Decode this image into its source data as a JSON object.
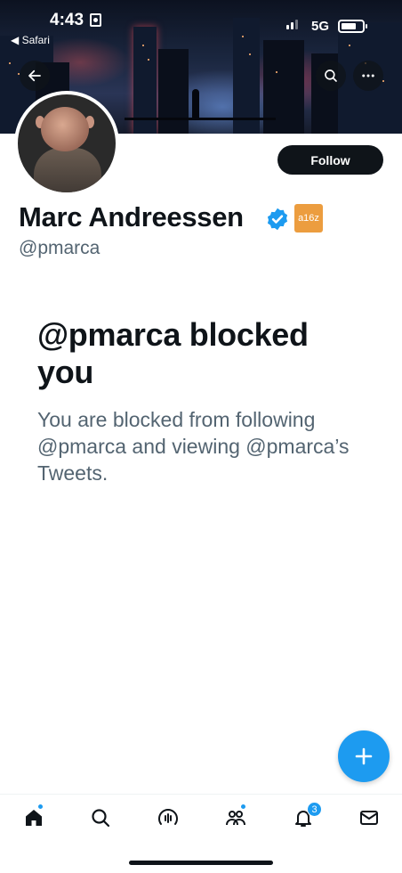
{
  "status_bar": {
    "time": "4:43",
    "back_app": "◀ Safari",
    "network": "5G"
  },
  "header": {
    "back_icon": "arrow-left-icon",
    "search_icon": "search-icon",
    "more_icon": "more-horizontal-icon"
  },
  "profile": {
    "display_name": "Marc Andreessen",
    "handle": "@pmarca",
    "affiliate_badge": "a16z",
    "follow_label": "Follow",
    "verified_color": "#1d9bf0",
    "affiliate_color": "#ec9d3f"
  },
  "blocked": {
    "title": "@pmarca blocked you",
    "description": "You are blocked from following @pmarca and viewing @pmarca’s Tweets."
  },
  "tab_bar": {
    "items": [
      {
        "name": "home",
        "icon": "home-icon",
        "has_dot": true
      },
      {
        "name": "search",
        "icon": "search-icon",
        "has_dot": false
      },
      {
        "name": "spaces",
        "icon": "spaces-icon",
        "has_dot": false
      },
      {
        "name": "communities",
        "icon": "communities-icon",
        "has_dot": true
      },
      {
        "name": "notifications",
        "icon": "bell-icon",
        "badge": "3"
      },
      {
        "name": "messages",
        "icon": "mail-icon",
        "has_dot": false
      }
    ]
  },
  "colors": {
    "accent": "#1d9bf0",
    "text_primary": "#0f1419",
    "text_secondary": "#536471"
  }
}
